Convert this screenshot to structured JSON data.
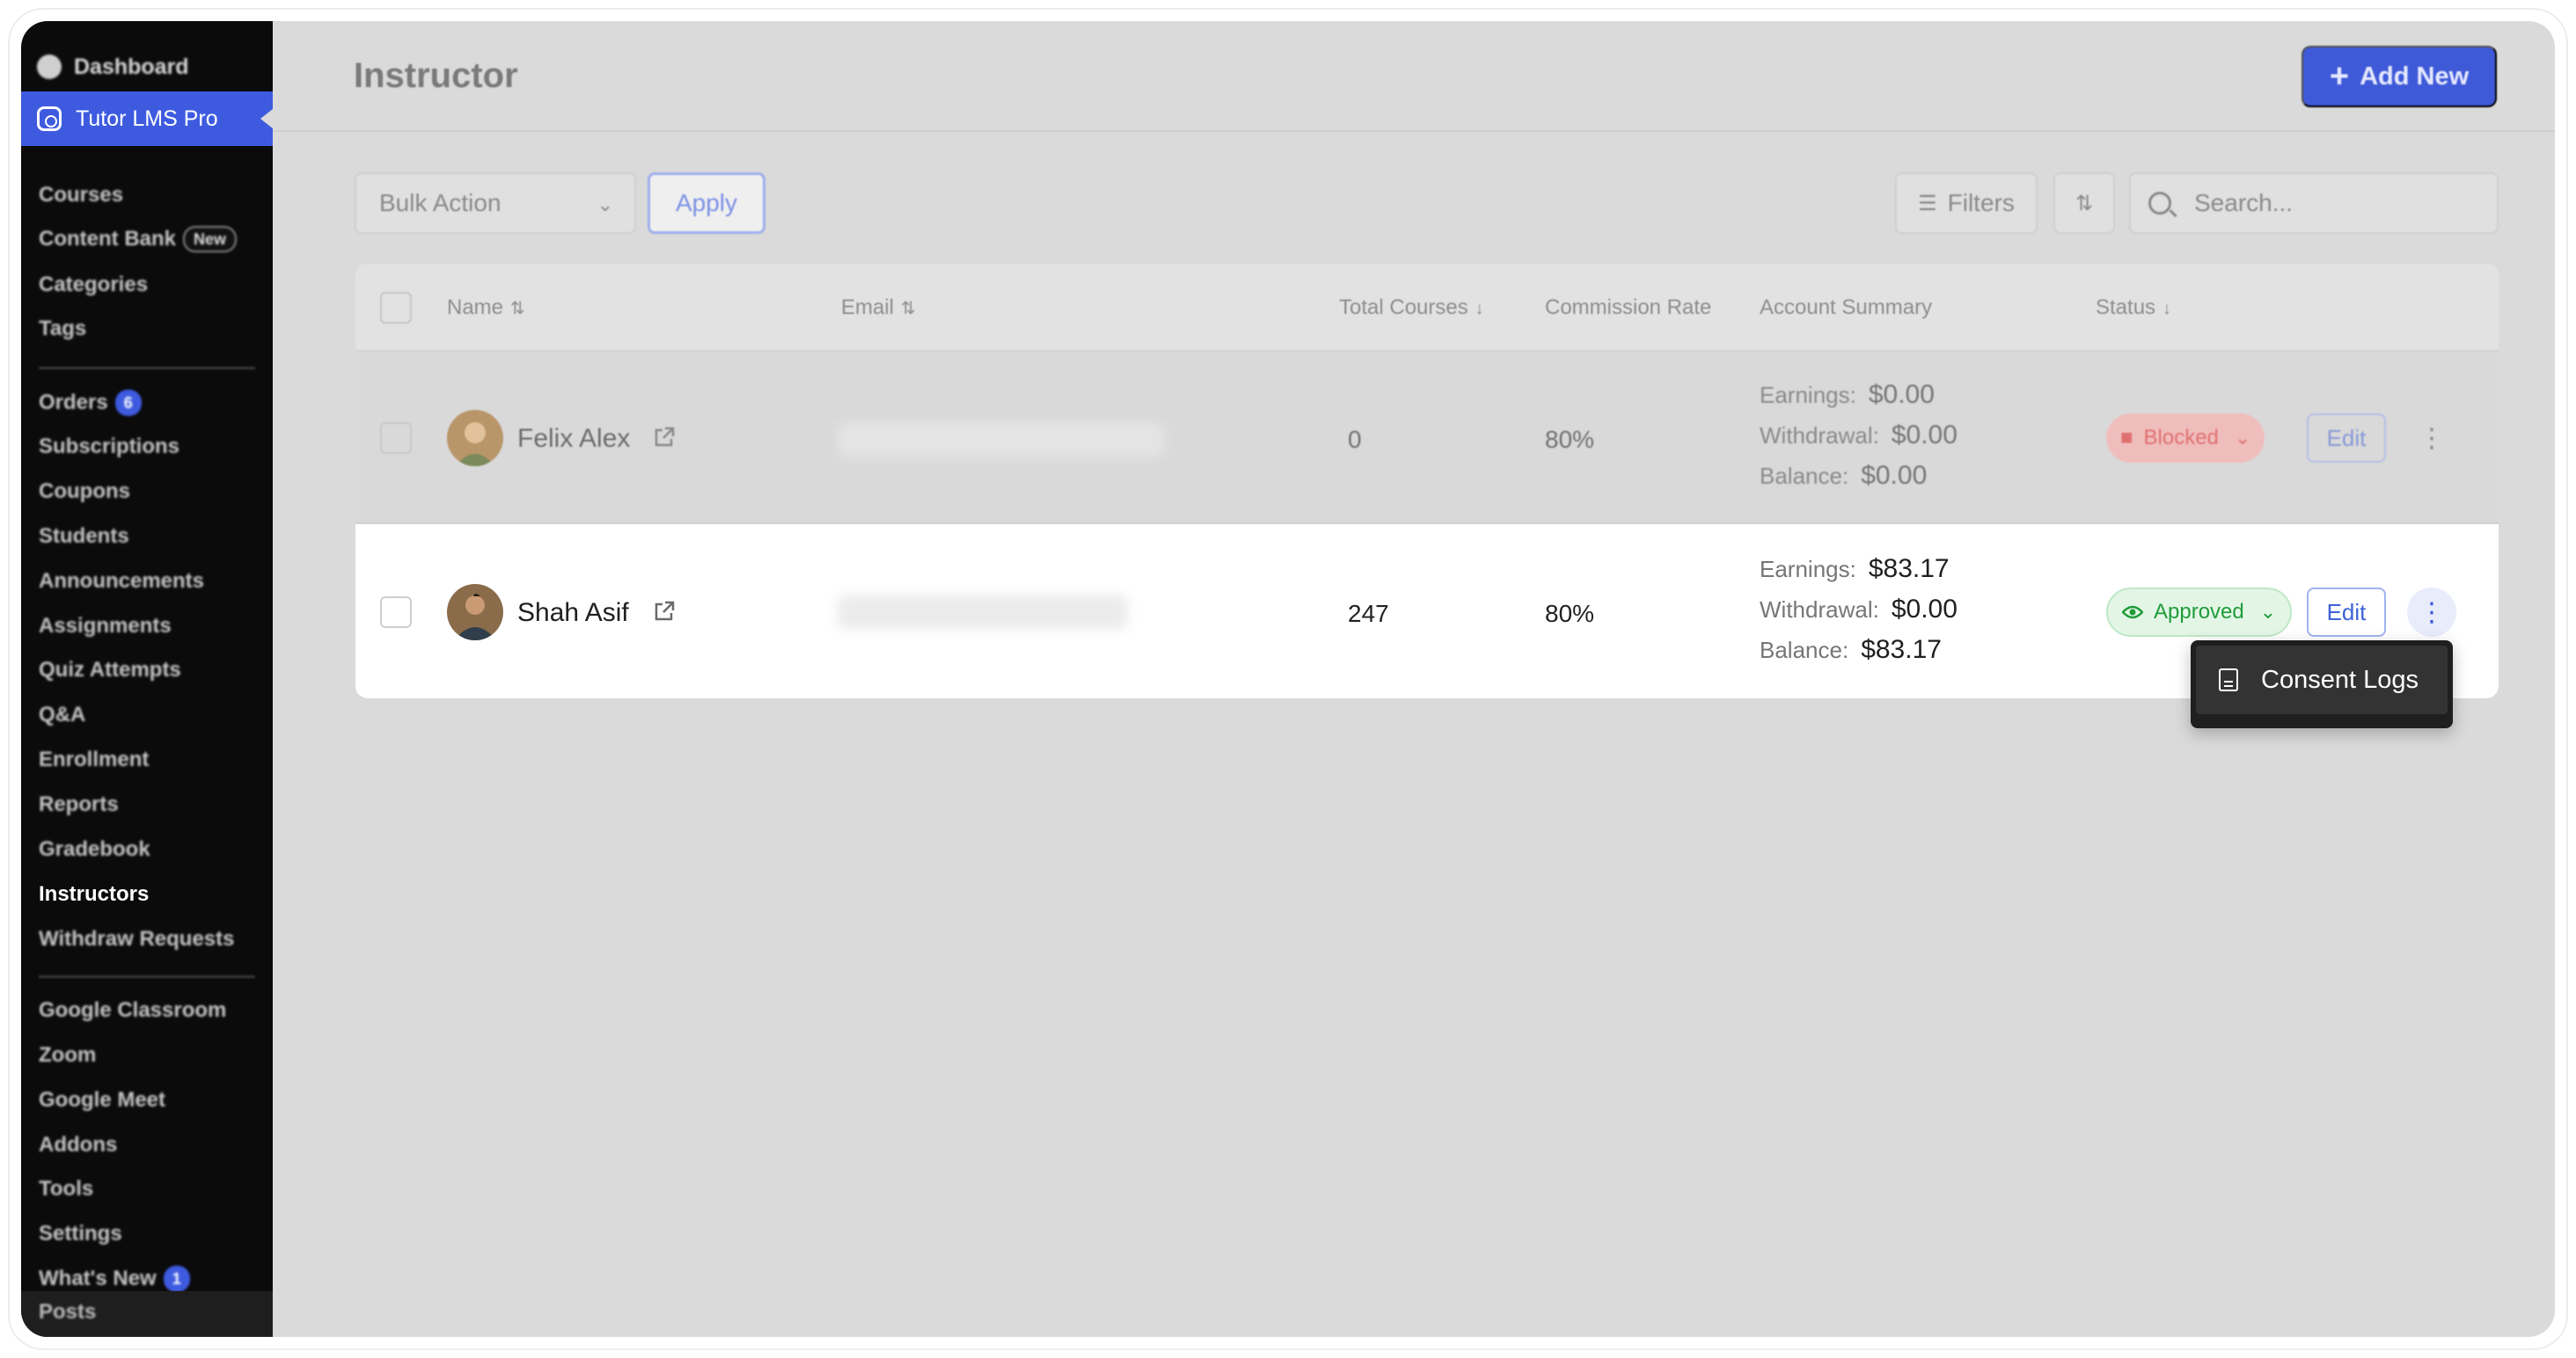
{
  "sidebar": {
    "dashboard": "Dashboard",
    "active": "Tutor LMS Pro",
    "groups": [
      [
        {
          "label": "Courses"
        },
        {
          "label": "Content Bank",
          "tag": "New"
        },
        {
          "label": "Categories"
        },
        {
          "label": "Tags"
        }
      ],
      [
        {
          "label": "Orders",
          "badge": "6"
        },
        {
          "label": "Subscriptions"
        },
        {
          "label": "Coupons"
        },
        {
          "label": "Students"
        },
        {
          "label": "Announcements"
        },
        {
          "label": "Assignments"
        },
        {
          "label": "Quiz Attempts"
        },
        {
          "label": "Q&A"
        },
        {
          "label": "Enrollment"
        },
        {
          "label": "Reports"
        },
        {
          "label": "Gradebook"
        },
        {
          "label": "Instructors",
          "current": true
        },
        {
          "label": "Withdraw Requests"
        }
      ],
      [
        {
          "label": "Google Classroom"
        },
        {
          "label": "Zoom"
        },
        {
          "label": "Google Meet"
        },
        {
          "label": "Addons"
        },
        {
          "label": "Tools"
        },
        {
          "label": "Settings"
        },
        {
          "label": "What's New",
          "badge": "1"
        }
      ]
    ],
    "bottom": "Posts"
  },
  "header": {
    "title": "Instructor",
    "add_new": "Add New"
  },
  "toolbar": {
    "bulk_action": "Bulk Action",
    "apply": "Apply",
    "filters": "Filters",
    "search_placeholder": "Search..."
  },
  "table": {
    "columns": {
      "name": "Name",
      "email": "Email",
      "total_courses": "Total Courses",
      "commission_rate": "Commission Rate",
      "account_summary": "Account Summary",
      "status": "Status"
    },
    "summary_labels": {
      "earnings": "Earnings:",
      "withdrawal": "Withdrawal:",
      "balance": "Balance:"
    },
    "rows": [
      {
        "name": "Felix Alex",
        "total_courses": "0",
        "commission_rate": "80%",
        "earnings": "$0.00",
        "withdrawal": "$0.00",
        "balance": "$0.00",
        "status": "Blocked",
        "edit": "Edit"
      },
      {
        "name": "Shah Asif",
        "total_courses": "247",
        "commission_rate": "80%",
        "earnings": "$83.17",
        "withdrawal": "$0.00",
        "balance": "$83.17",
        "status": "Approved",
        "edit": "Edit"
      }
    ]
  },
  "dropdown": {
    "item": "Consent Logs"
  },
  "colors": {
    "accent": "#3e5be0",
    "approved": "#1f9c3a",
    "blocked": "#e07070"
  }
}
